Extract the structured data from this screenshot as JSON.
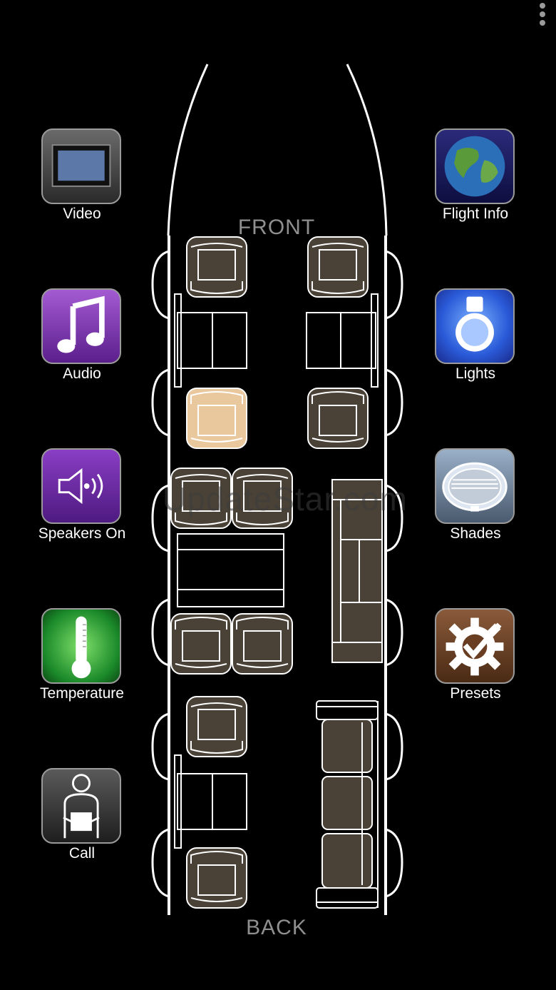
{
  "left_buttons": [
    {
      "label": "Video",
      "icon": "video-screen-icon"
    },
    {
      "label": "Audio",
      "icon": "music-note-icon"
    },
    {
      "label": "Speakers On",
      "icon": "speaker-icon"
    },
    {
      "label": "Temperature",
      "icon": "thermometer-icon"
    },
    {
      "label": "Call",
      "icon": "attendant-icon"
    }
  ],
  "right_buttons": [
    {
      "label": "Flight Info",
      "icon": "globe-icon"
    },
    {
      "label": "Lights",
      "icon": "light-bulb-icon"
    },
    {
      "label": "Shades",
      "icon": "window-shade-icon"
    },
    {
      "label": "Presets",
      "icon": "gear-check-icon"
    }
  ],
  "cabin": {
    "front_label": "FRONT",
    "back_label": "BACK",
    "selected_seat": "seat-left-row-2"
  },
  "watermark": "UpdateStar.com",
  "colors": {
    "background": "#000000",
    "outline": "#ffffff",
    "seat_fill": "#4a4236",
    "seat_selected": "#e8c89c",
    "label": "#ffffff",
    "zone_label": "#8f8f8f"
  }
}
